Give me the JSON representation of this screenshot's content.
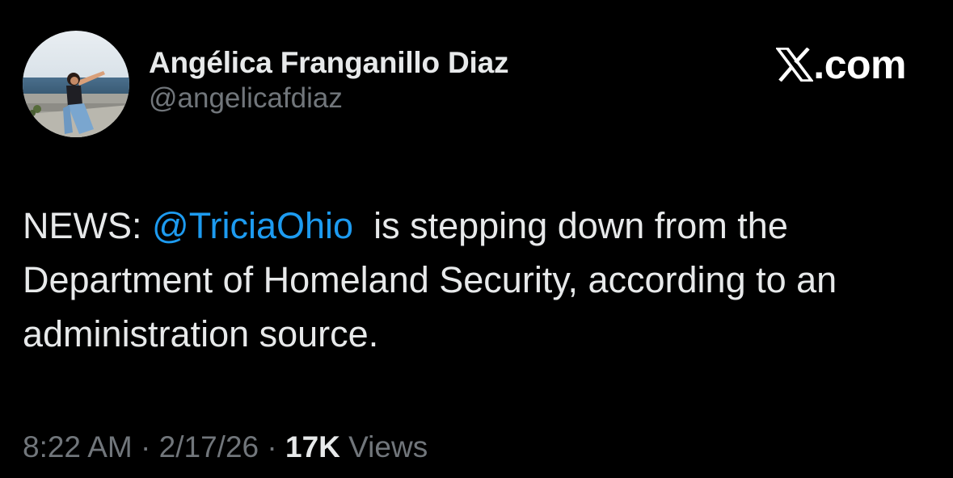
{
  "author": {
    "display_name": "Angélica Franganillo Diaz",
    "handle": "@angelicafdiaz",
    "avatar": "profile-photo"
  },
  "brand": {
    "icon": "x-logo-icon",
    "label": ".com"
  },
  "tweet": {
    "prefix": "NEWS: ",
    "mention": "@TriciaOhio",
    "body": "  is stepping down from the Department of Homeland Security, according to an administration source."
  },
  "meta": {
    "time": "8:22 AM",
    "sep1": " · ",
    "date": "2/17/26",
    "sep2": " · ",
    "views_count": "17K",
    "views_label": " Views"
  },
  "colors": {
    "background": "#000000",
    "text_primary": "#e7e9ea",
    "text_secondary": "#71767b",
    "link": "#1d9bf0"
  }
}
